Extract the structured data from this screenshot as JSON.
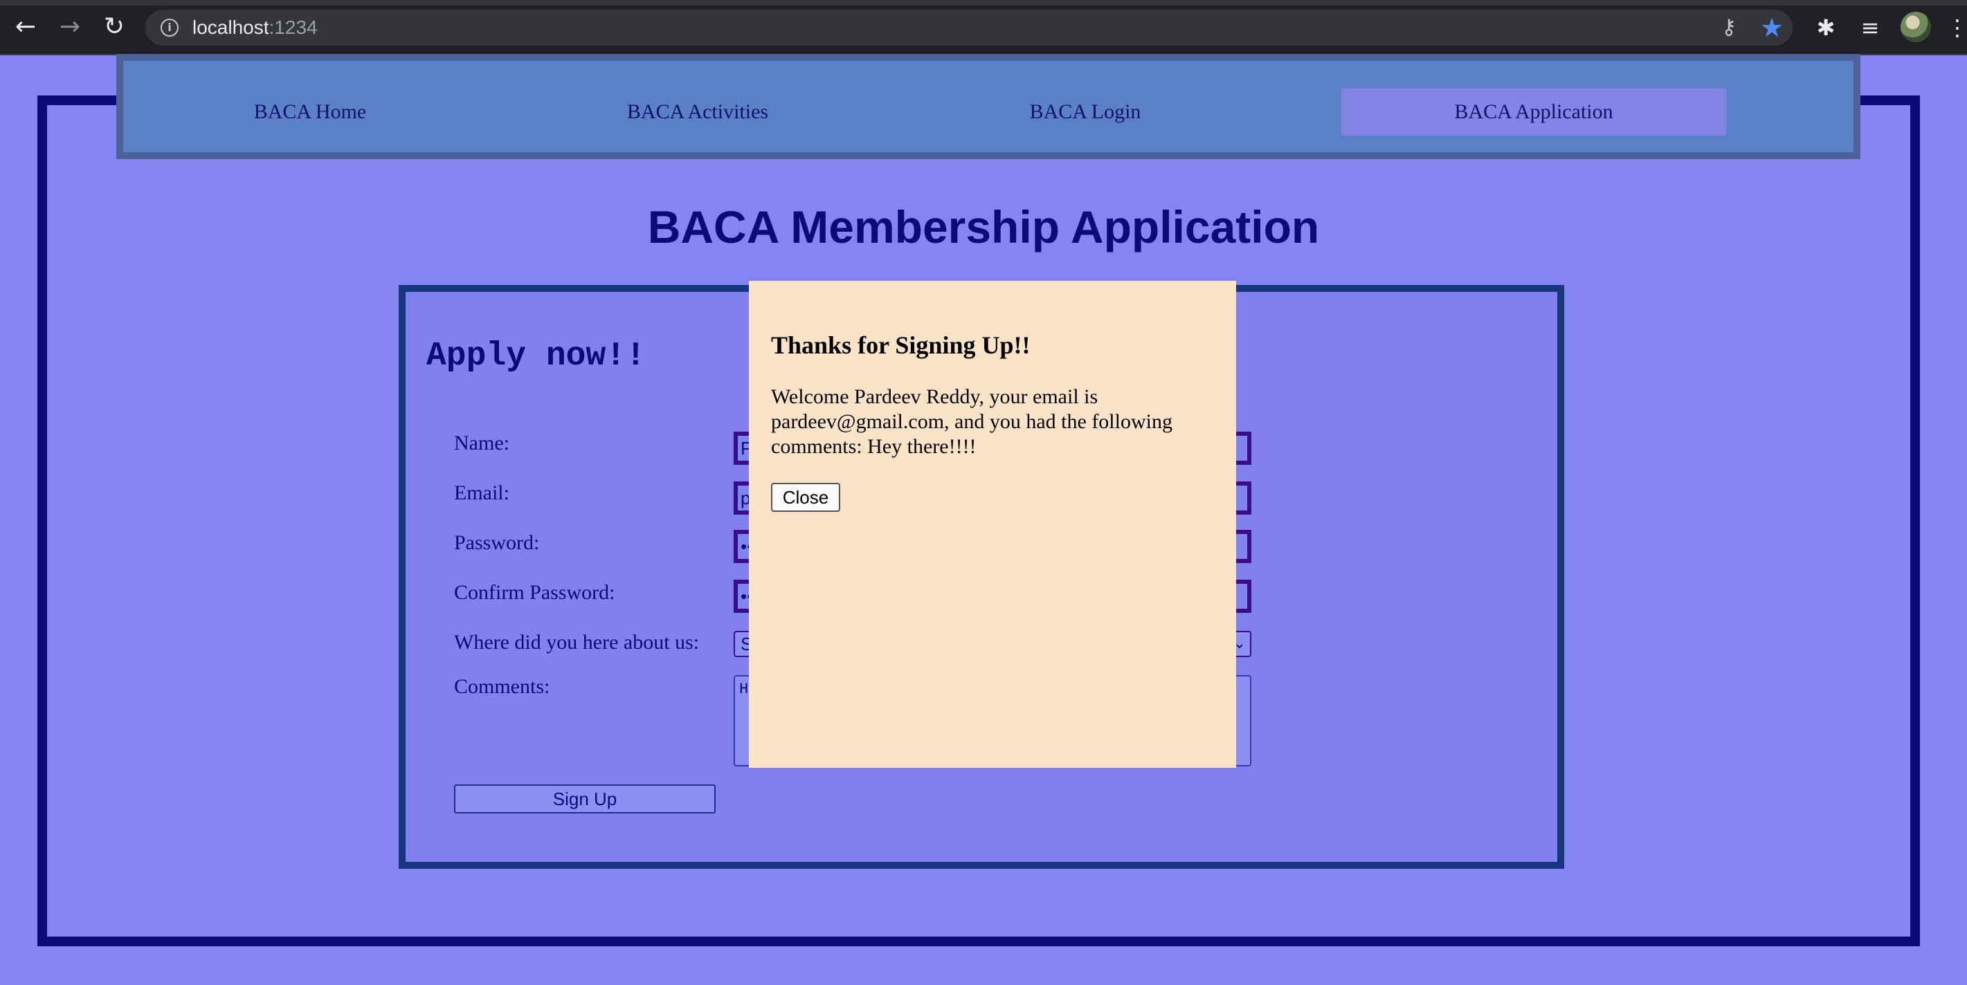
{
  "browser": {
    "url_host": "localhost",
    "url_port": ":1234",
    "back_icon": "←",
    "forward_icon": "→",
    "reload_icon": "↻",
    "info_icon": "i",
    "key_icon": "⚷",
    "star_icon": "★",
    "extensions_icon": "✱",
    "media_icon": "≡",
    "menu_icon": "⋮"
  },
  "nav": {
    "items": [
      {
        "label": "BACA Home"
      },
      {
        "label": "BACA Activities"
      },
      {
        "label": "BACA Login"
      },
      {
        "label": "BACA Application"
      }
    ],
    "active": "BACA Application"
  },
  "page": {
    "title": "BACA Membership Application"
  },
  "form": {
    "heading": "Apply now!!",
    "labels": {
      "name": "Name:",
      "email": "Email:",
      "password": "Password:",
      "confirm_password": "Confirm Password:",
      "source": "Where did you here about us:",
      "comments": "Comments:"
    },
    "values": {
      "name": "P",
      "email": "p",
      "password": "••",
      "confirm_password": "••",
      "source": "S",
      "comments": "H"
    },
    "signup_label": "Sign Up"
  },
  "modal": {
    "title": "Thanks for Signing Up!!",
    "message": "Welcome Pardeev Reddy, your email is pardeev@gmail.com, and you had the following comments: Hey there!!!!",
    "close_label": "Close"
  },
  "colors": {
    "page_bg": "#8484f2",
    "frame": "#0a0a78",
    "navbar_bg": "#5a80c6",
    "modal_bg": "#fae3c6",
    "accent_star": "#4d8bf5"
  }
}
